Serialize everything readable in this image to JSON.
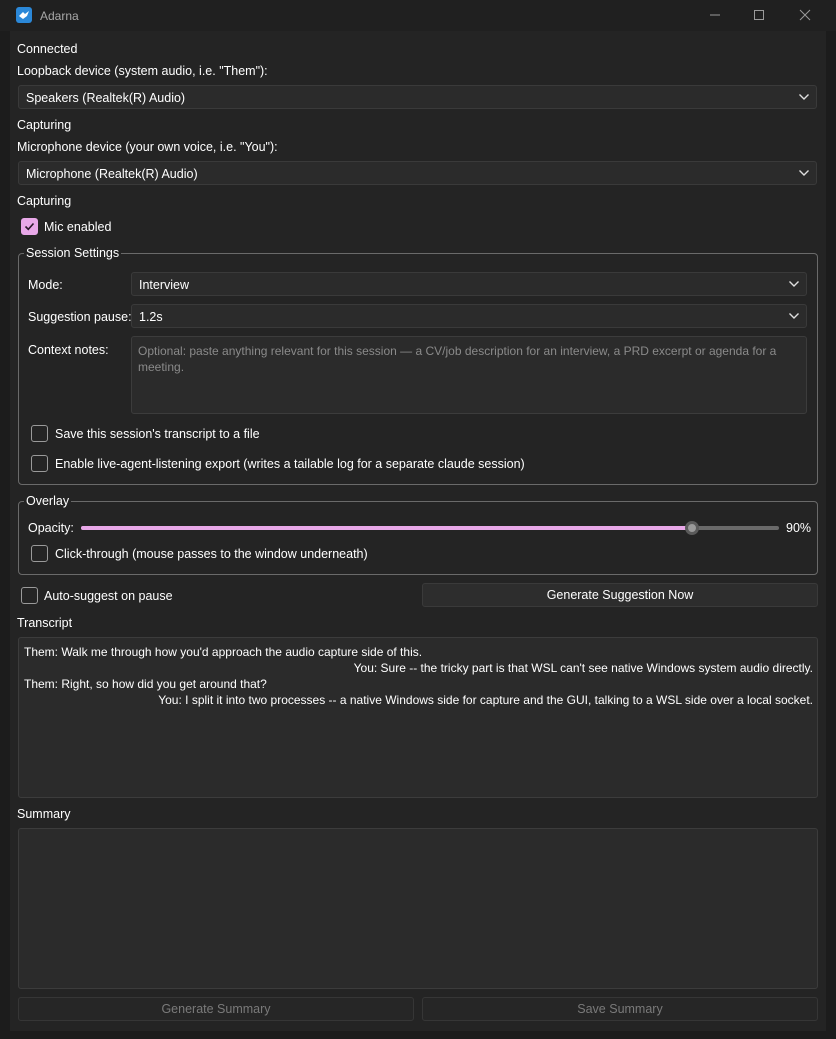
{
  "window": {
    "title": "Adarna"
  },
  "loopback": {
    "status": "Connected",
    "label": "Loopback device (system audio, i.e. \"Them\"):",
    "selected": "Speakers (Realtek(R) Audio)",
    "capture_status": "Capturing"
  },
  "microphone": {
    "label": "Microphone device (your own voice, i.e. \"You\"):",
    "selected": "Microphone (Realtek(R) Audio)",
    "capture_status": "Capturing",
    "enabled_label": "Mic enabled",
    "enabled": true
  },
  "session": {
    "title": "Session Settings",
    "mode_label": "Mode:",
    "mode_value": "Interview",
    "pause_label": "Suggestion pause:",
    "pause_value": "1.2s",
    "context_label": "Context notes:",
    "context_placeholder": "Optional: paste anything relevant for this session — a CV/job description for an interview, a PRD excerpt or agenda for a meeting.",
    "save_transcript_label": "Save this session's transcript to a file",
    "save_transcript": false,
    "export_label": "Enable live-agent-listening export (writes a tailable log for a separate claude session)",
    "export": false
  },
  "overlay": {
    "title": "Overlay",
    "opacity_label": "Opacity:",
    "opacity_value": 0.9,
    "opacity_text": "90%",
    "clickthrough_label": "Click-through (mouse passes to the window underneath)",
    "clickthrough": false
  },
  "suggest": {
    "auto_label": "Auto-suggest on pause",
    "auto": false,
    "generate_button": "Generate Suggestion Now"
  },
  "transcript": {
    "label": "Transcript",
    "lines": [
      {
        "speaker": "Them",
        "text": "Them: Walk me through how you'd approach the audio capture side of this."
      },
      {
        "speaker": "You",
        "text": "You: Sure -- the tricky part is that WSL can't see native Windows system audio directly."
      },
      {
        "speaker": "Them",
        "text": "Them: Right, so how did you get around that?"
      },
      {
        "speaker": "You",
        "text": "You: I split it into two processes -- a native Windows side for capture and the GUI, talking to a WSL side over a local socket."
      }
    ]
  },
  "summary": {
    "label": "Summary",
    "generate_button": "Generate Summary",
    "save_button": "Save Summary"
  },
  "colors": {
    "accent": "#e8a8e8",
    "background": "#242424",
    "field": "#2b2b2b"
  }
}
